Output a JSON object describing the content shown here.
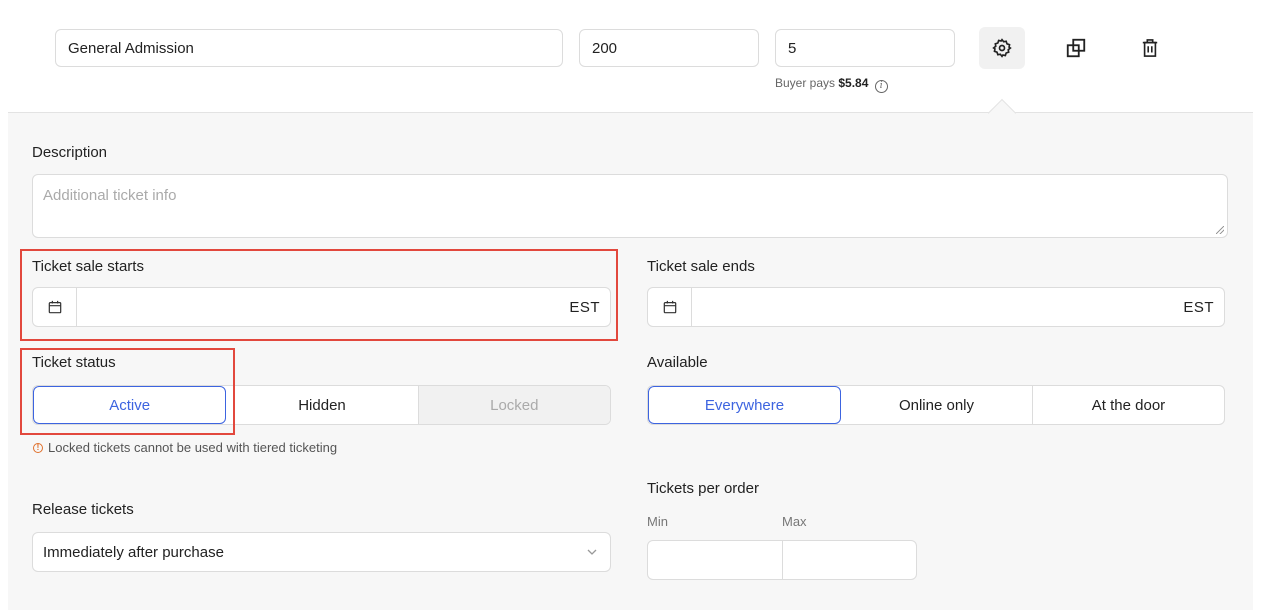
{
  "ticket": {
    "name": "General Admission",
    "quantity": "200",
    "price": "5",
    "buyer_pays_prefix": "Buyer pays",
    "buyer_pays_amount": "$5.84",
    "info_glyph": "i"
  },
  "icons": {
    "settings": "gear-icon",
    "duplicate": "duplicate-icon",
    "delete": "trash-icon",
    "calendar": "calendar-icon",
    "chevron": "chevron-down-icon",
    "warning": "warning-icon"
  },
  "settings": {
    "description": {
      "label": "Description",
      "placeholder": "Additional ticket info"
    },
    "sale_starts": {
      "label": "Ticket sale starts",
      "timezone": "EST"
    },
    "sale_ends": {
      "label": "Ticket sale ends",
      "timezone": "EST"
    },
    "status": {
      "label": "Ticket status",
      "options": [
        "Active",
        "Hidden",
        "Locked"
      ],
      "selected": "Active",
      "disabled": "Locked",
      "warning_glyph": "!",
      "warning": "Locked tickets cannot be used with tiered ticketing"
    },
    "available": {
      "label": "Available",
      "options": [
        "Everywhere",
        "Online only",
        "At the door"
      ],
      "selected": "Everywhere"
    },
    "release": {
      "label": "Release tickets",
      "value": "Immediately after purchase"
    },
    "per_order": {
      "label": "Tickets per order",
      "min_label": "Min",
      "max_label": "Max"
    }
  },
  "colors": {
    "accent": "#3d64e0",
    "highlight": "#e2483d",
    "warning": "#e0702c",
    "panel_bg": "#f7f7f7"
  }
}
